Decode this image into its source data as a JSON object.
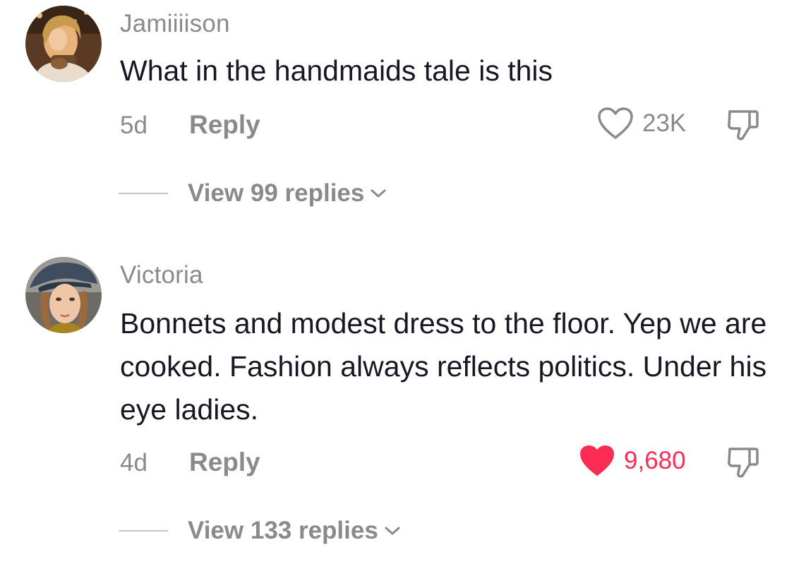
{
  "comments": [
    {
      "username": "Jamiiiison",
      "text": "What in the handmaids tale is this",
      "age": "5d",
      "reply_label": "Reply",
      "likes": "23K",
      "liked": false,
      "view_replies": "View 99 replies"
    },
    {
      "username": "Victoria",
      "text": "Bonnets and modest dress to the floor. Yep we are cooked. Fashion always reflects politics. Under his eye ladies.",
      "age": "4d",
      "reply_label": "Reply",
      "likes": "9,680",
      "liked": true,
      "view_replies": "View 133 replies"
    }
  ],
  "icons": {
    "like": "heart-icon",
    "dislike": "thumbs-down-icon",
    "expand": "chevron-down-icon"
  },
  "colors": {
    "liked_red": "#fe2c55",
    "muted_gray": "#8a8a8a",
    "text_dark": "#161823"
  }
}
